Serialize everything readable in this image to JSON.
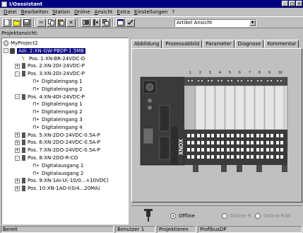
{
  "window": {
    "title": "I/Oassistant",
    "buttons": [
      "_",
      "□",
      "×"
    ]
  },
  "menu": [
    "Datei",
    "Bearbeiten",
    "Station",
    "Online",
    "Ansicht",
    "Extra",
    "Einstellungen",
    "?"
  ],
  "toolbar": {
    "view_select_value": "Artikel Ansicht",
    "icons": [
      "new-icon",
      "open-icon",
      "save-icon",
      "cut-icon",
      "copy-icon",
      "paste-icon",
      "delete-icon",
      "module-icon",
      "io-icon",
      "copy2-icon",
      "window-icon",
      "check-icon"
    ]
  },
  "project_panel": {
    "label": "Projektansicht:",
    "tree": [
      {
        "text": "MyProject2",
        "icon": "project",
        "exp": "",
        "indent": 0
      },
      {
        "text": "Adr. 2:XN-GW-PBDP-1.5MB",
        "icon": "gateway",
        "exp": "-",
        "indent": 1,
        "selected": true
      },
      {
        "text": "Pos. 1:XN-BR-24VDC-D",
        "icon": "bolt",
        "exp": "",
        "indent": 2
      },
      {
        "text": "Pos. 2:XN-2DI-24VDC-P",
        "icon": "module",
        "exp": "+",
        "indent": 2
      },
      {
        "text": "Pos. 3:XN-2DI-24VDC-P",
        "icon": "module",
        "exp": "-",
        "indent": 2
      },
      {
        "text": "Digitaleingang 1",
        "icon": "channel",
        "exp": "",
        "indent": 3
      },
      {
        "text": "Digitaleingang 2",
        "icon": "channel",
        "exp": "",
        "indent": 3
      },
      {
        "text": "Pos. 4:XN-4DI-24VDC-P",
        "icon": "module",
        "exp": "-",
        "indent": 2
      },
      {
        "text": "Digitaleingang 1",
        "icon": "channel",
        "exp": "",
        "indent": 3
      },
      {
        "text": "Digitaleingang 2",
        "icon": "channel",
        "exp": "",
        "indent": 3
      },
      {
        "text": "Digitaleingang 3",
        "icon": "channel",
        "exp": "",
        "indent": 3
      },
      {
        "text": "Digitaleingang 4",
        "icon": "channel",
        "exp": "",
        "indent": 3
      },
      {
        "text": "Pos. 5:XN-2DO-24VDC-0.5A-P",
        "icon": "module",
        "exp": "+",
        "indent": 2
      },
      {
        "text": "Pos. 6:XN-2DO-24VDC-0.5A-P",
        "icon": "module",
        "exp": "+",
        "indent": 2
      },
      {
        "text": "Pos. 7:XN-2DO-24VDC-0.5A-P",
        "icon": "module",
        "exp": "+",
        "indent": 2
      },
      {
        "text": "Pos. 8:XN-2DO-R-CO",
        "icon": "module",
        "exp": "-",
        "indent": 2
      },
      {
        "text": "Digitalausgang 1",
        "icon": "channel",
        "exp": "",
        "indent": 3
      },
      {
        "text": "Digitalausgang 2",
        "icon": "channel",
        "exp": "",
        "indent": 3
      },
      {
        "text": "Pos. 9:XN-1AI-U(-10/0...+10VDC)",
        "icon": "module",
        "exp": "+",
        "indent": 2
      },
      {
        "text": "Pos. 10:XN-1AO-I(0/4...20MA)",
        "icon": "module",
        "exp": "+",
        "indent": 2
      }
    ]
  },
  "tabs": [
    "Abbildung",
    "Prozessabbild",
    "Parameter",
    "Diagnose",
    "Kommentar"
  ],
  "picture": {
    "slot_numbers": [
      "1",
      "2",
      "3",
      "4",
      "5",
      "6",
      "7",
      "8",
      "9",
      "10"
    ],
    "brand": "XNOX"
  },
  "mode": {
    "options": [
      {
        "label": "Offline",
        "selected": true,
        "enabled": true
      },
      {
        "label": "Online R",
        "selected": false,
        "enabled": false
      },
      {
        "label": "Online R/W",
        "selected": false,
        "enabled": false
      }
    ]
  },
  "statusbar": [
    "Bereit",
    "Benutzer 1",
    "Projektieren",
    "ProfibusDP"
  ]
}
